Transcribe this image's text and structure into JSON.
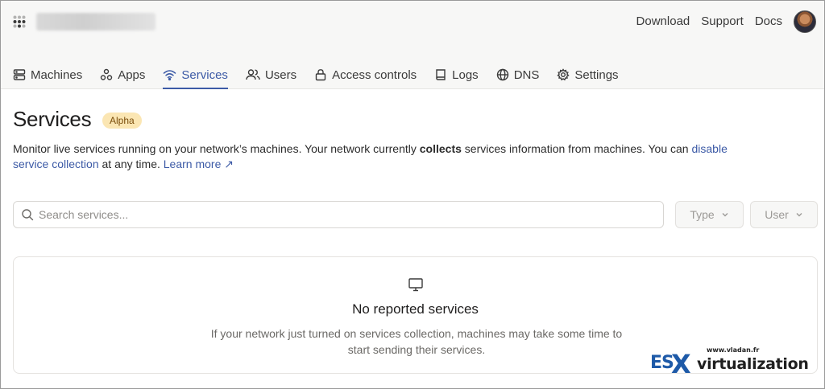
{
  "header": {
    "tailnet_name": "v",
    "links": [
      "Download",
      "Support",
      "Docs"
    ]
  },
  "tabs": [
    {
      "label": "Machines",
      "icon": "server-icon"
    },
    {
      "label": "Apps",
      "icon": "apps-icon"
    },
    {
      "label": "Services",
      "icon": "wifi-icon",
      "active": true
    },
    {
      "label": "Users",
      "icon": "users-icon"
    },
    {
      "label": "Access controls",
      "icon": "lock-icon"
    },
    {
      "label": "Logs",
      "icon": "book-icon"
    },
    {
      "label": "DNS",
      "icon": "globe-icon"
    },
    {
      "label": "Settings",
      "icon": "gear-icon"
    }
  ],
  "page": {
    "title": "Services",
    "badge": "Alpha",
    "desc_part1": "Monitor live services running on your network’s machines. Your network currently ",
    "desc_bold": "collects",
    "desc_part2": " services information from machines. You can ",
    "desc_link1": "disable service collection",
    "desc_part3": " at any time. ",
    "desc_link2": "Learn more ↗"
  },
  "search": {
    "placeholder": "Search services..."
  },
  "filters": {
    "type_label": "Type",
    "user_label": "User"
  },
  "empty_state": {
    "title": "No reported services",
    "message": "If your network just turned on services collection, machines may take some time to start sending their services."
  },
  "watermark": {
    "url": "www.vladan.fr",
    "es": "ES",
    "x": "X",
    "text": "virtualization"
  },
  "colors": {
    "accent": "#3c5aa6",
    "badge_bg": "#fbe6b3",
    "topbar_bg": "#f7f7f6"
  }
}
